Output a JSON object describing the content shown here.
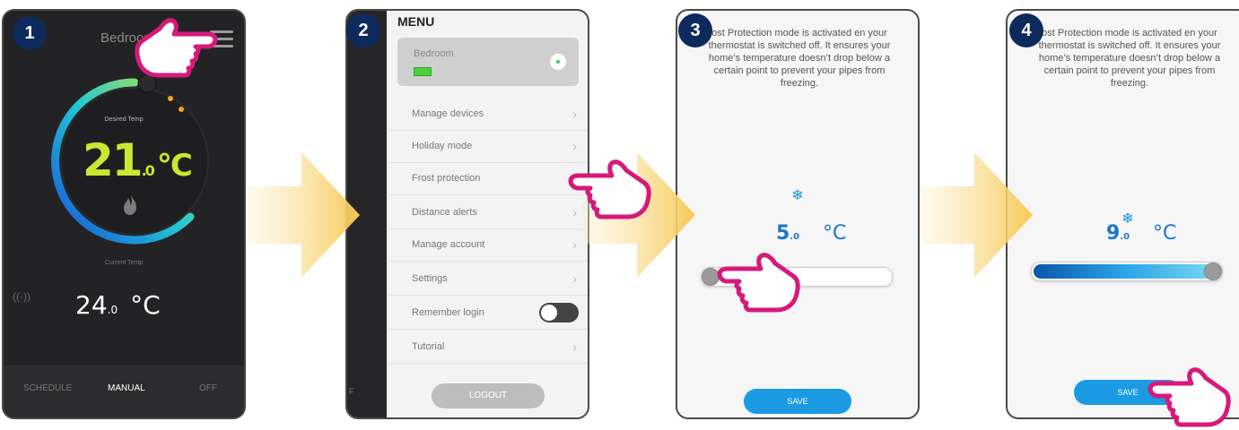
{
  "colors": {
    "badge": "#0d2a5c",
    "accent_blue": "#1a9be3",
    "hand_stroke": "#d6197a",
    "arrow": "#f7cc5f"
  },
  "steps": {
    "s1": "1",
    "s2": "2",
    "s3": "3",
    "s4": "4"
  },
  "screen1": {
    "title": "Bedroom",
    "desired_label": "Desired Temp",
    "desired_temp_int": "21",
    "desired_temp_dec": ".0",
    "desired_temp_unit": "°C",
    "current_label": "Current Temp",
    "current_temp_int": "24",
    "current_temp_dec": ".0",
    "current_temp_unit": "°C",
    "tabs": {
      "schedule": "SCHEDULE",
      "manual": "MANUAL",
      "off": "OFF"
    }
  },
  "screen2": {
    "menu_title": "MENU",
    "profile_name": "Bedroom",
    "strip_text": "F",
    "items": [
      "Manage devices",
      "Holiday mode",
      "Frost protection",
      "Distance alerts",
      "Manage account",
      "Settings",
      "Remember login",
      "Tutorial"
    ],
    "logout": "LOGOUT"
  },
  "screen3": {
    "description": "ost Protection mode is activated en your thermostat is switched off. It ensures your home’s temperature doesn’t drop below a certain point to prevent your pipes from freezing.",
    "temp_int": "5",
    "temp_dec": ".0",
    "unit": "°C",
    "slider_level": 0,
    "save": "SAVE"
  },
  "screen4": {
    "description": "ost Protection mode is activated en your thermostat is switched off. It ensures your home’s temperature doesn’t drop below a certain point to prevent your pipes from freezing.",
    "temp_int": "9",
    "temp_dec": ".0",
    "unit": "°C",
    "slider_level": 1,
    "save": "SAVE"
  }
}
